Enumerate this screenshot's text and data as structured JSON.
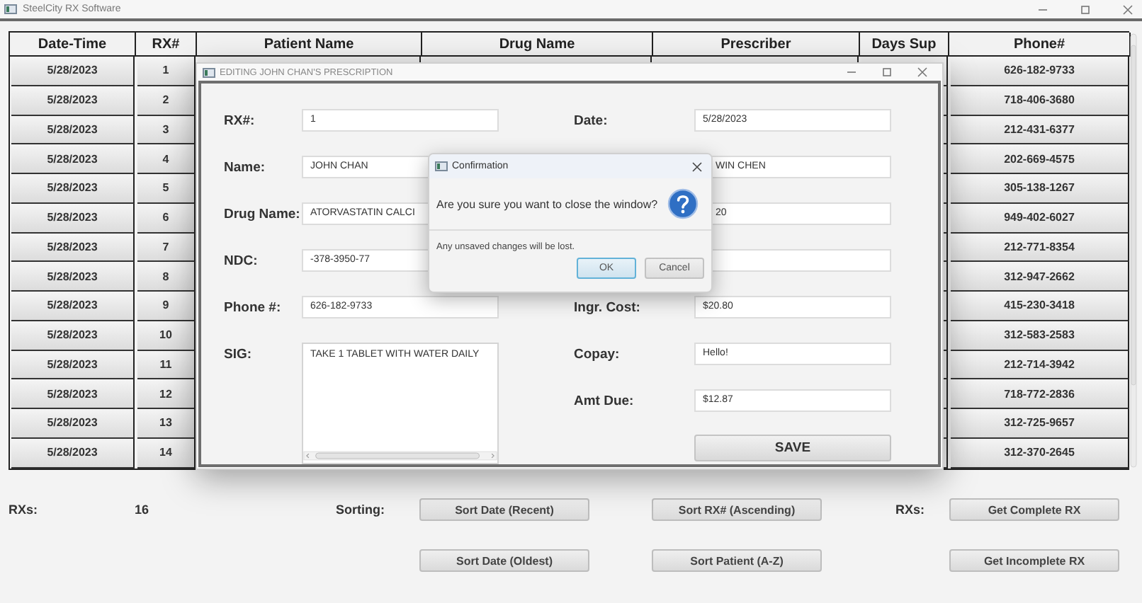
{
  "window": {
    "title": "SteelCity RX Software"
  },
  "table": {
    "columns": [
      "Date-Time",
      "RX#",
      "Patient Name",
      "Drug Name",
      "Prescriber",
      "Days Sup",
      "Phone#"
    ],
    "rows": [
      {
        "date": "5/28/2023",
        "rx": "1",
        "phone": "626-182-9733"
      },
      {
        "date": "5/28/2023",
        "rx": "2",
        "phone": "718-406-3680"
      },
      {
        "date": "5/28/2023",
        "rx": "3",
        "phone": "212-431-6377"
      },
      {
        "date": "5/28/2023",
        "rx": "4",
        "phone": "202-669-4575"
      },
      {
        "date": "5/28/2023",
        "rx": "5",
        "phone": "305-138-1267"
      },
      {
        "date": "5/28/2023",
        "rx": "6",
        "phone": "949-402-6027"
      },
      {
        "date": "5/28/2023",
        "rx": "7",
        "phone": "212-771-8354"
      },
      {
        "date": "5/28/2023",
        "rx": "8",
        "phone": "312-947-2662"
      },
      {
        "date": "5/28/2023",
        "rx": "9",
        "phone": "415-230-3418"
      },
      {
        "date": "5/28/2023",
        "rx": "10",
        "phone": "312-583-2583"
      },
      {
        "date": "5/28/2023",
        "rx": "11",
        "phone": "212-714-3942"
      },
      {
        "date": "5/28/2023",
        "rx": "12",
        "phone": "718-772-2836"
      },
      {
        "date": "5/28/2023",
        "rx": "13",
        "phone": "312-725-9657"
      },
      {
        "date": "5/28/2023",
        "rx": "14",
        "phone": "312-370-2645"
      }
    ]
  },
  "footer": {
    "count_label": "RXs:",
    "count": "16",
    "sorting_label": "Sorting:",
    "rx_label": "RXs:",
    "sort_buttons": [
      "Sort Date (Recent)",
      "Sort RX# (Ascending)",
      "Sort Date (Oldest)",
      "Sort Patient (A-Z)"
    ],
    "rx_buttons": [
      "Get Complete RX",
      "Get Incomplete RX"
    ]
  },
  "editor": {
    "title": "EDITING JOHN CHAN'S PRESCRIPTION",
    "left_fields": [
      {
        "kind": "text",
        "label": "RX#:",
        "value": "1"
      },
      {
        "kind": "text",
        "label": "Name:",
        "value": "JOHN CHAN"
      },
      {
        "kind": "text",
        "label": "Drug Name:",
        "value": "ATORVASTATIN CALCI"
      },
      {
        "kind": "text",
        "label": "NDC:",
        "value": "-378-3950-77"
      },
      {
        "kind": "text",
        "label": "Phone #:",
        "value": "626-182-9733"
      },
      {
        "kind": "textarea",
        "label": "SIG:",
        "value": "TAKE 1 TABLET WITH WATER DAILY"
      }
    ],
    "right_fields": [
      {
        "kind": "text",
        "label": "Date:",
        "value": "5/28/2023"
      },
      {
        "kind": "covered",
        "value": "WIN CHEN"
      },
      {
        "kind": "covered",
        "value": "20"
      },
      {
        "kind": "covered"
      },
      {
        "kind": "text",
        "label": "Ingr. Cost:",
        "value": "$20.80"
      },
      {
        "kind": "text",
        "label": "Copay:",
        "value": "Hello!"
      },
      {
        "kind": "text",
        "label": "Amt Due:",
        "value": "$12.87"
      }
    ],
    "save_button": "SAVE"
  },
  "confirm": {
    "title": "Confirmation",
    "question": "Are you sure you want to close the window?",
    "detail": "Any unsaved changes will be lost.",
    "buttons": [
      {
        "label": "OK",
        "focused": true
      },
      {
        "label": "Cancel",
        "focused": false
      }
    ]
  }
}
